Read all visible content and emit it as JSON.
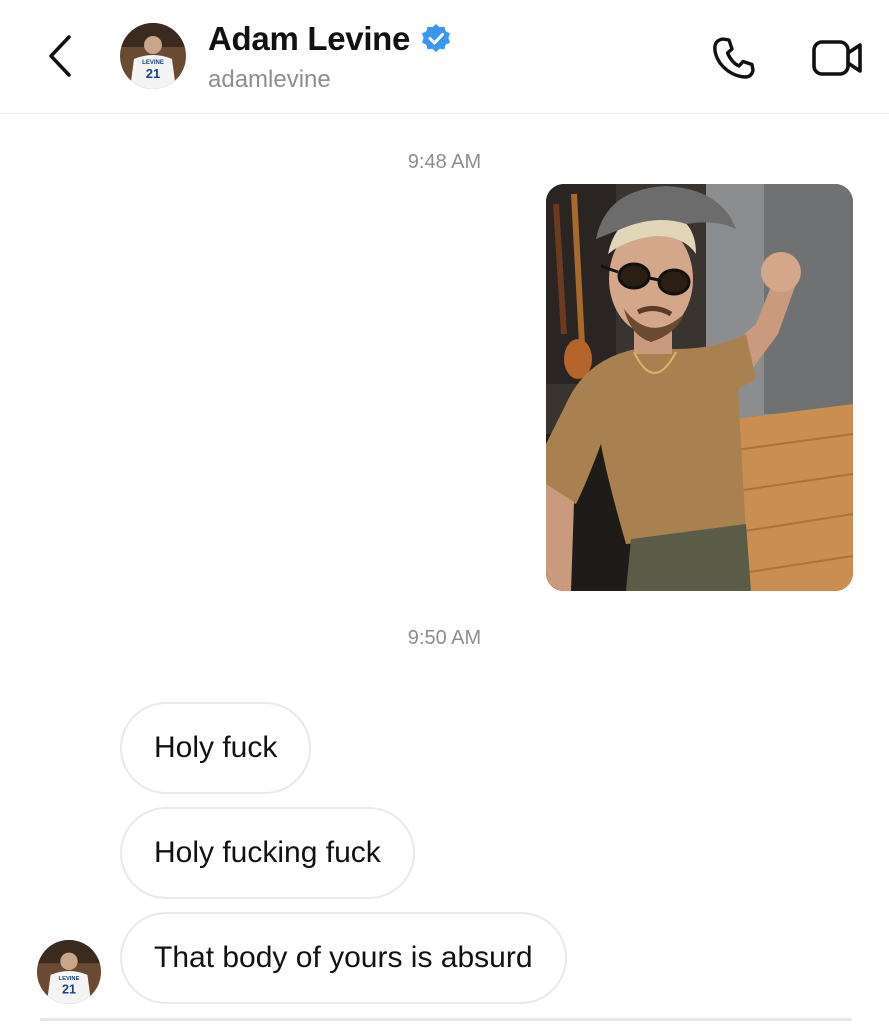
{
  "header": {
    "contact_name": "Adam Levine",
    "handle": "adamlevine",
    "verified": true,
    "icons": {
      "back": "chevron-left-icon",
      "verified": "verified-badge-icon",
      "call": "phone-icon",
      "video": "video-camera-icon"
    }
  },
  "avatar_jersey": {
    "name": "LEVINE",
    "number": "21"
  },
  "thread": {
    "timestamps": [
      "9:48 AM",
      "9:50 AM"
    ],
    "sent_photo": "photo",
    "messages": [
      {
        "sender": "adamlevine",
        "text": "Holy fuck"
      },
      {
        "sender": "adamlevine",
        "text": "Holy fucking fuck"
      },
      {
        "sender": "adamlevine",
        "text": "That body of yours is absurd"
      }
    ]
  },
  "colors": {
    "verified_blue": "#3897f0",
    "meta_gray": "#8e8e8e",
    "bubble_border": "#e9e9e9"
  }
}
